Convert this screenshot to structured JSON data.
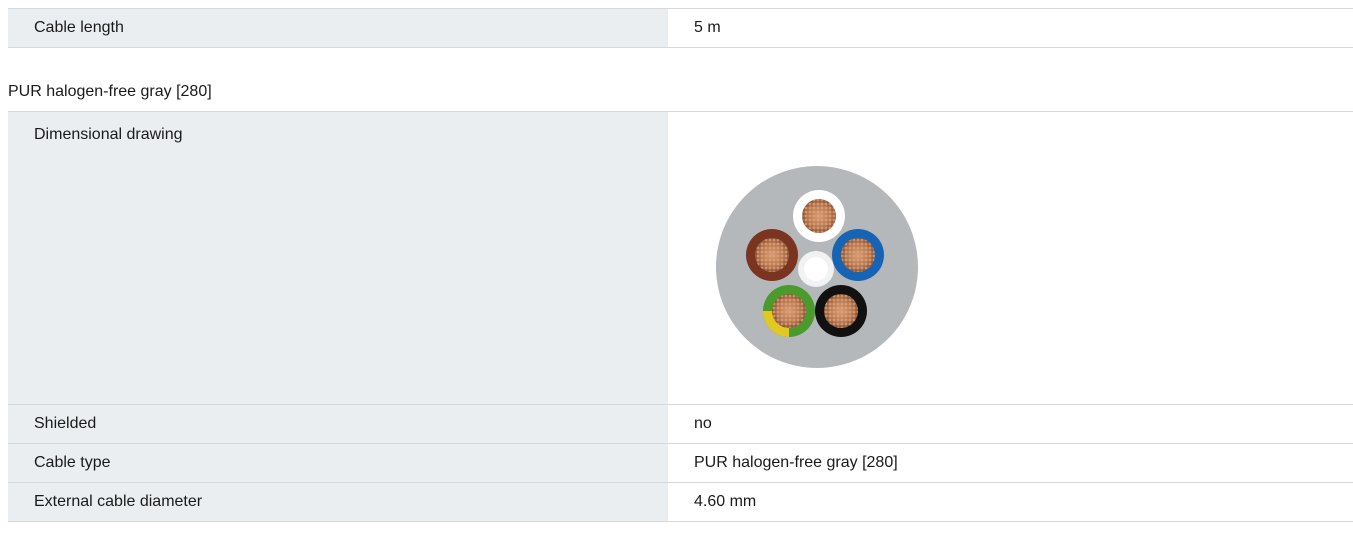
{
  "top_table": {
    "rows": [
      {
        "label": "Cable length",
        "value": "5 m"
      }
    ]
  },
  "section": {
    "title": "PUR halogen-free gray [280]"
  },
  "details_table": {
    "drawing_label": "Dimensional drawing",
    "rows": [
      {
        "label": "Shielded",
        "value": "no"
      },
      {
        "label": "Cable type",
        "value": "PUR halogen-free gray [280]"
      },
      {
        "label": "External cable diameter",
        "value": "4.60 mm"
      }
    ]
  },
  "drawing": {
    "icon": "cable-cross-section",
    "colors": {
      "sheath": "#b5b8bb",
      "core_white": "#ffffff",
      "core_brown": "#7b3420",
      "core_blue": "#1764b5",
      "core_green_yellow": "#4a9a2e",
      "core_black": "#111111",
      "copper": "#b5754e"
    }
  }
}
